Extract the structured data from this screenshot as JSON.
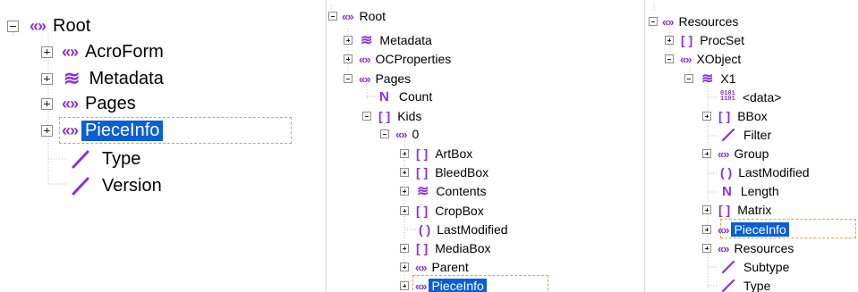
{
  "panels": {
    "left": {
      "root": {
        "label": "Root"
      },
      "items": [
        {
          "label": "AcroForm"
        },
        {
          "label": "Metadata"
        },
        {
          "label": "Pages"
        },
        {
          "label": "PieceInfo"
        },
        {
          "label": "Type"
        },
        {
          "label": "Version"
        }
      ]
    },
    "middle": {
      "root": {
        "label": "Root"
      },
      "metadata": {
        "label": "Metadata"
      },
      "ocproperties": {
        "label": "OCProperties"
      },
      "pages": {
        "label": "Pages"
      },
      "count": {
        "label": "Count"
      },
      "kids": {
        "label": "Kids"
      },
      "kid0": {
        "label": "0"
      },
      "kid_items": [
        {
          "label": "ArtBox"
        },
        {
          "label": "BleedBox"
        },
        {
          "label": "Contents"
        },
        {
          "label": "CropBox"
        },
        {
          "label": "LastModified"
        },
        {
          "label": "MediaBox"
        },
        {
          "label": "Parent"
        },
        {
          "label": "PieceInfo"
        }
      ]
    },
    "right": {
      "resources": {
        "label": "Resources"
      },
      "procset": {
        "label": "ProcSet"
      },
      "xobject": {
        "label": "XObject"
      },
      "x1": {
        "label": "X1"
      },
      "x1_items": [
        {
          "label": "<data>"
        },
        {
          "label": "BBox"
        },
        {
          "label": "Filter"
        },
        {
          "label": "Group"
        },
        {
          "label": "LastModified"
        },
        {
          "label": "Length"
        },
        {
          "label": "Matrix"
        },
        {
          "label": "PieceInfo"
        },
        {
          "label": "Resources"
        },
        {
          "label": "Subtype"
        },
        {
          "label": "Type"
        }
      ]
    }
  },
  "icons": {
    "dict": "dictionary-icon",
    "array": "array-icon",
    "stream": "stream-icon",
    "name": "name-icon",
    "number": "number-icon",
    "string": "string-icon",
    "data": "binary-data-icon"
  },
  "colors": {
    "icon": "#8b2fe0",
    "selection": "#0a5fd6",
    "focus": "#e3a236"
  }
}
